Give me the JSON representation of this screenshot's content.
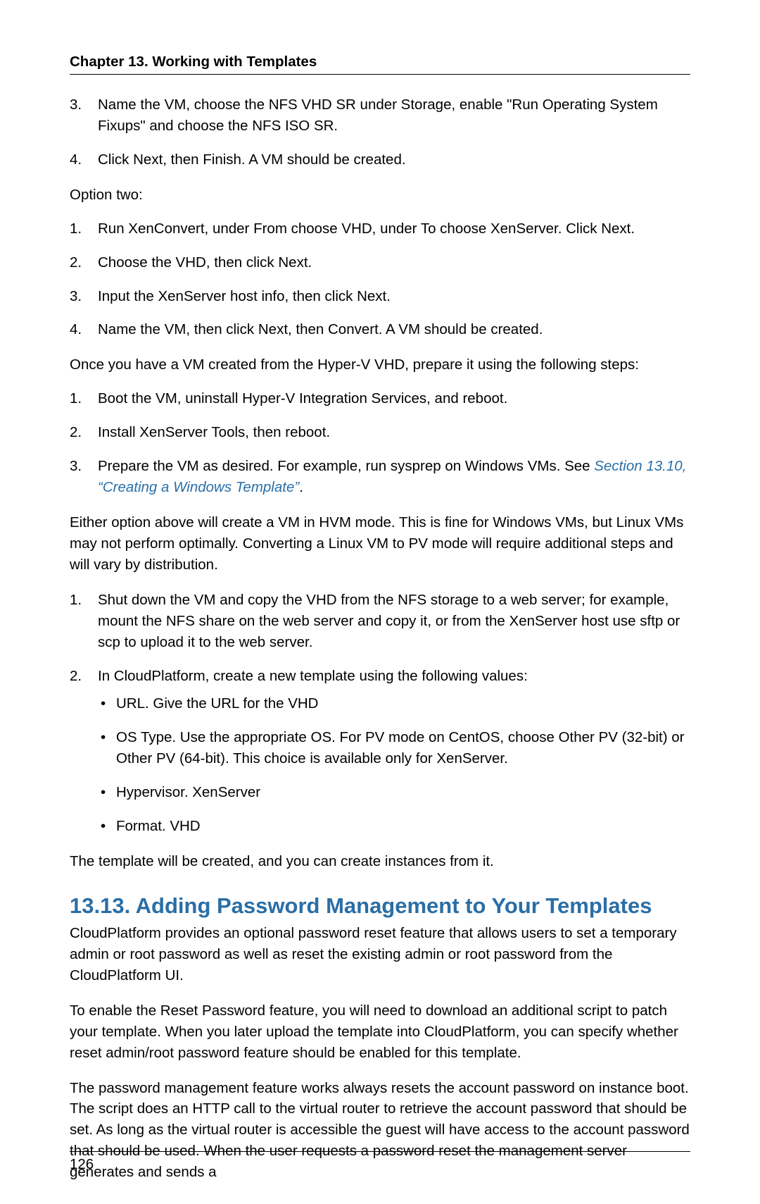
{
  "header": {
    "chapter_title": "Chapter 13. Working with Templates"
  },
  "listA": {
    "items": [
      {
        "num": "3.",
        "text": "Name the VM, choose the NFS VHD SR under Storage, enable \"Run Operating System Fixups\" and choose the NFS ISO SR."
      },
      {
        "num": "4.",
        "text": "Click Next, then Finish. A VM should be created."
      }
    ]
  },
  "option_two_label": "Option two:",
  "listB": {
    "items": [
      {
        "num": "1.",
        "text": "Run XenConvert, under From choose VHD, under To choose XenServer. Click Next."
      },
      {
        "num": "2.",
        "text": "Choose the VHD, then click Next."
      },
      {
        "num": "3.",
        "text": "Input the XenServer host info, then click Next."
      },
      {
        "num": "4.",
        "text": "Name the VM, then click Next, then Convert. A VM should be created."
      }
    ]
  },
  "para_once_vm": "Once you have a VM created from the Hyper-V VHD, prepare it using the following steps:",
  "listC": {
    "items": [
      {
        "num": "1.",
        "text": "Boot the VM, uninstall Hyper-V Integration Services, and reboot."
      },
      {
        "num": "2.",
        "text": "Install XenServer Tools, then reboot."
      }
    ],
    "item3_num": "3.",
    "item3_prefix": "Prepare the VM as desired. For example, run sysprep on Windows VMs. See ",
    "item3_link": "Section 13.10, “Creating a Windows Template”",
    "item3_suffix": "."
  },
  "para_either": "Either option above will create a VM in HVM mode. This is fine for Windows VMs, but Linux VMs may not perform optimally. Converting a Linux VM to PV mode will require additional steps and will vary by distribution.",
  "listD": {
    "item1_num": "1.",
    "item1_text": "Shut down the VM and copy the VHD from the NFS storage to a web server; for example, mount the NFS share on the web server and copy it, or from the XenServer host use sftp or scp to upload it to the web server.",
    "item2_num": "2.",
    "item2_text": "In CloudPlatform, create a new template using the following values:",
    "bullets": [
      "URL. Give the URL for the VHD",
      "OS Type. Use the appropriate OS. For PV mode on CentOS, choose Other PV (32-bit) or Other PV (64-bit). This choice is available only for XenServer.",
      "Hypervisor. XenServer",
      "Format. VHD"
    ]
  },
  "para_template_created": "The template will be created, and you can create instances from it.",
  "section_heading": "13.13. Adding Password Management to Your Templates",
  "para_sec1": "CloudPlatform provides an optional password reset feature that allows users to set a temporary admin or root password as well as reset the existing admin or root password from the CloudPlatform UI.",
  "para_sec2": "To enable the Reset Password feature, you will need to download an additional script to patch your template. When you later upload the template into CloudPlatform, you can specify whether reset admin/root password feature should be enabled for this template.",
  "para_sec3": "The password management feature works always resets the account password on instance boot. The script does an HTTP call to the virtual router to retrieve the account password that should be set. As long as the virtual router is accessible the guest will have access to the account password that should be used. When the user requests a password reset the management server generates and sends a",
  "footer": {
    "page_number": "126"
  }
}
